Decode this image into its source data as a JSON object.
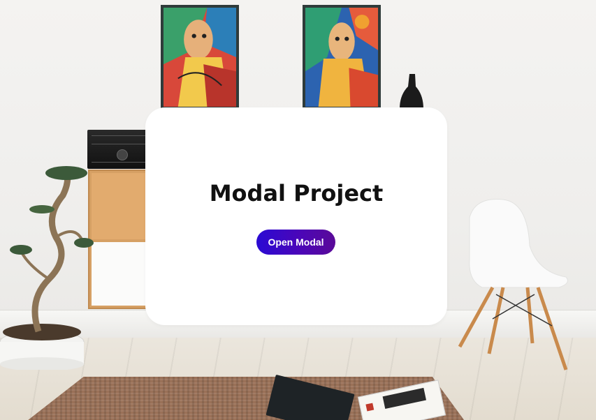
{
  "page": {
    "title": "Modal Project"
  },
  "modal_trigger": {
    "label": "Open Modal"
  },
  "colors": {
    "card_background": "#ffffff",
    "button_gradient_start": "#2a0ad3",
    "button_gradient_end": "#5a0a98",
    "button_text": "#ffffff",
    "title_text": "#111111"
  },
  "background": {
    "scene": "living-room-photo",
    "elements": [
      "painting-icon",
      "painting-icon",
      "vase-icon",
      "stereo-icon",
      "cabinet-icon",
      "bonsai-plant-icon",
      "white-chair-icon",
      "rug-icon",
      "book-icon",
      "book-icon"
    ]
  }
}
